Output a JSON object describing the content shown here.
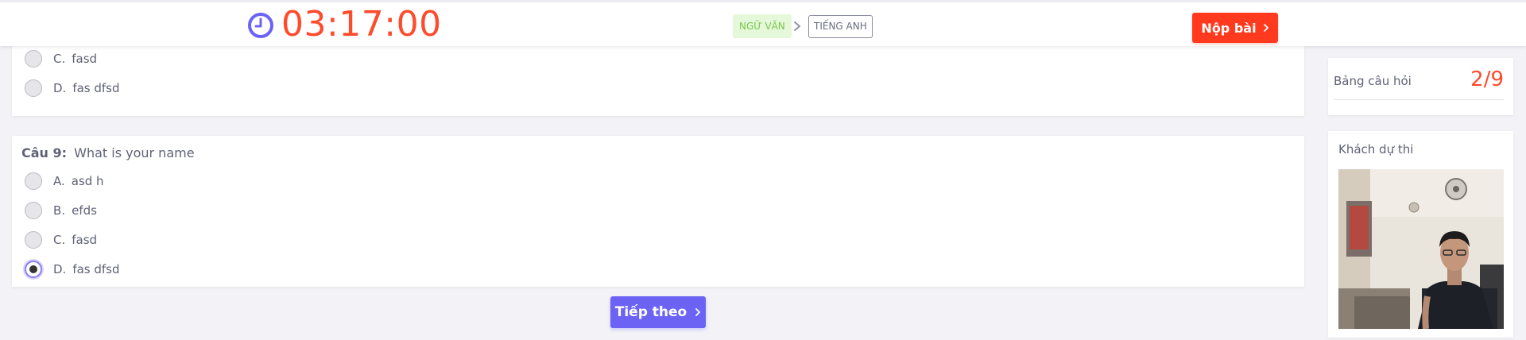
{
  "header": {
    "timer": "03:17:00",
    "subjects": [
      "NGỮ VĂN",
      "TIẾNG ANH"
    ],
    "submit_label": "Nộp bài"
  },
  "colors": {
    "accent": "#6c63f5",
    "timer": "#ff4a2b",
    "submit": "#ff3a1e",
    "subject_active": "#78c74a"
  },
  "previous_question": {
    "options": [
      {
        "letter": "C.",
        "text": "fasd",
        "selected": false
      },
      {
        "letter": "D.",
        "text": "fas dfsd",
        "selected": false
      }
    ]
  },
  "question": {
    "number": "Câu 9:",
    "text": "What is your name",
    "options": [
      {
        "letter": "A.",
        "text": "asd h",
        "selected": false
      },
      {
        "letter": "B.",
        "text": "efds",
        "selected": false
      },
      {
        "letter": "C.",
        "text": "fasd",
        "selected": false
      },
      {
        "letter": "D.",
        "text": "fas dfsd",
        "selected": true
      }
    ]
  },
  "next_label": "Tiếp theo",
  "sidebar": {
    "question_board_label": "Bảng câu hỏi",
    "question_board_count": "2/9",
    "candidate_label": "Khách dự thi"
  },
  "icons": {
    "timer": "clock-icon",
    "subject_separator": "chevron-right-icon",
    "submit": "chevron-right-icon",
    "next": "chevron-right-icon"
  }
}
